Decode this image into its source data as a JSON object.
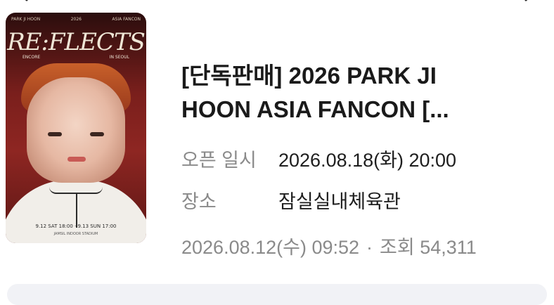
{
  "event": {
    "title": "[단독판매]   2026 PARK JI HOON ASIA FANCON [...",
    "open_label": "오픈 일시",
    "open_value": "2026.08.18(화) 20:00",
    "place_label": "장소",
    "place_value": "잠실실내체육관",
    "posted_date": "2026.08.12(수) 09:52",
    "separator": "·",
    "views_label": "조회",
    "views_count": "54,311"
  },
  "poster": {
    "top_left": "PARK JI HOON",
    "top_center": "2026",
    "top_right": "ASIA FANCON",
    "title": "RE:FLECTS",
    "sub_left": "ENCORE",
    "sub_right": "IN SEOUL",
    "dates": "9.12 SAT 18:00 · 9.13 SUN 17:00",
    "venue": "JAMSIL INDOOR STADIUM"
  },
  "colors": {
    "label_gray": "#8a8a8a",
    "text_dark": "#1a1a1a",
    "bar_bg": "#f1f2f6"
  },
  "icons": {
    "top_left": "chevron-left-icon",
    "top_right": "chevron-down-icon"
  }
}
